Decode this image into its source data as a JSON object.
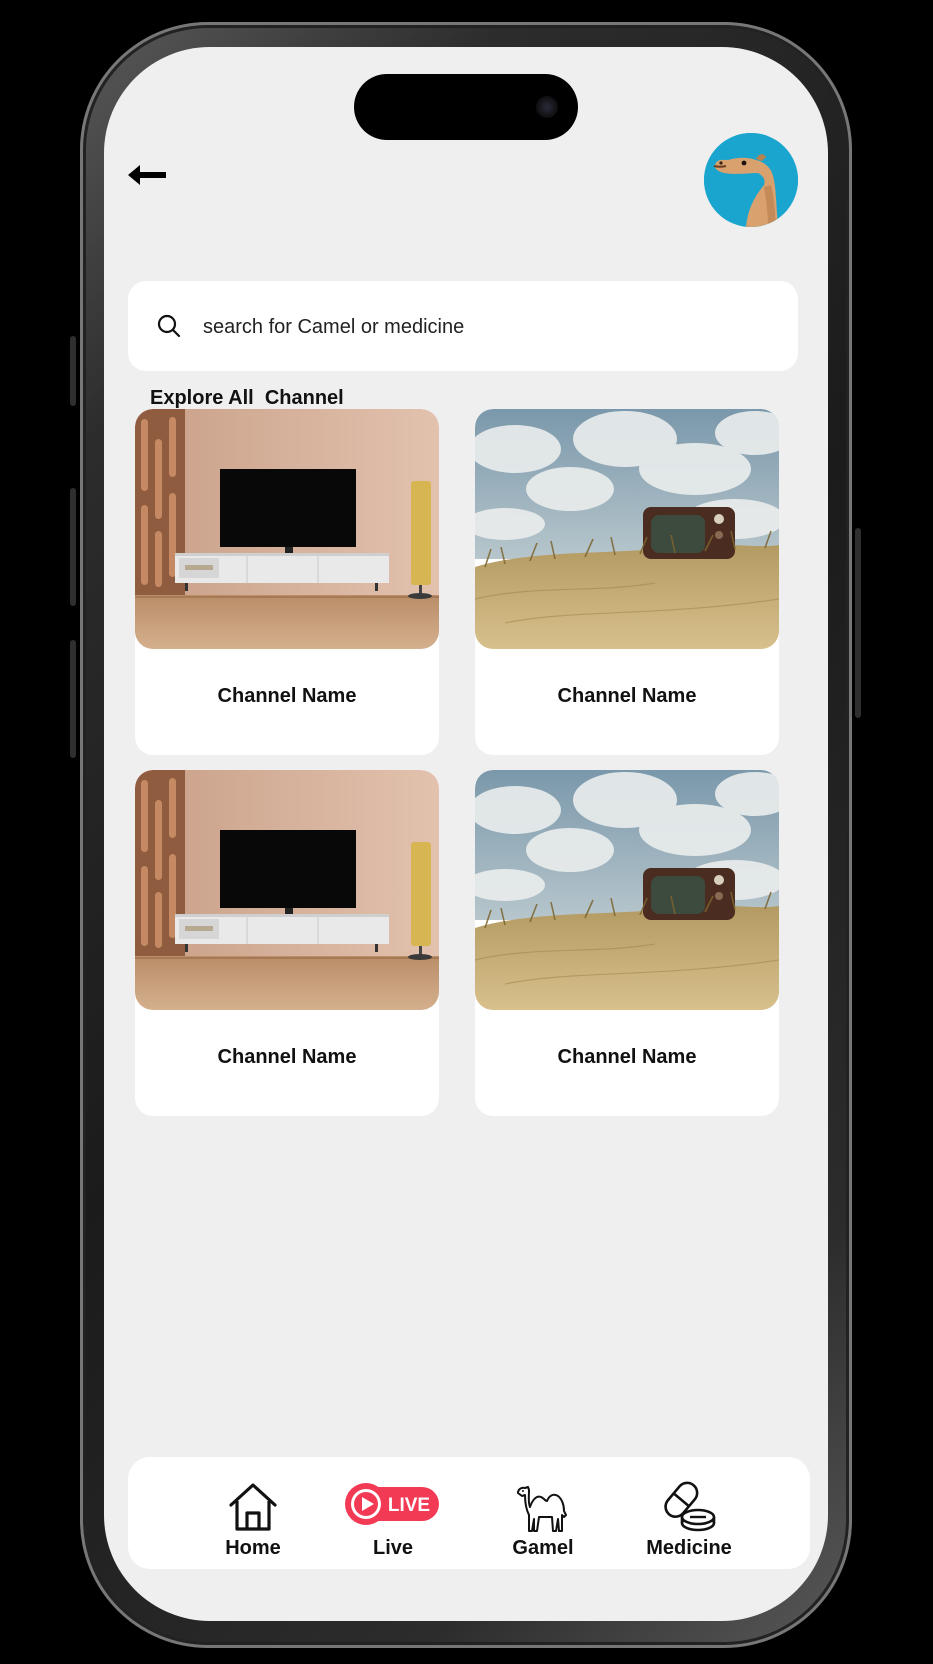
{
  "search": {
    "placeholder": "search for Camel or medicine"
  },
  "section": {
    "title": "Explore All  Channel"
  },
  "channels": [
    {
      "name": "Channel Name",
      "image": "tv-stand-room-image"
    },
    {
      "name": "Channel Name",
      "image": "retro-tv-in-sand-image"
    },
    {
      "name": "Channel Name",
      "image": "tv-stand-room-image"
    },
    {
      "name": "Channel Name",
      "image": "retro-tv-in-sand-image"
    }
  ],
  "nav": {
    "home": "Home",
    "live": "Live",
    "live_badge": "LIVE",
    "gamel": "Gamel",
    "medicine": "Medicine"
  },
  "colors": {
    "background": "#f0eff0",
    "live_accent": "#f23a55",
    "avatar_bg": "#1aa5cf"
  },
  "icons": [
    "back-arrow-icon",
    "search-icon",
    "home-icon",
    "live-icon",
    "camel-icon",
    "medicine-icon"
  ]
}
